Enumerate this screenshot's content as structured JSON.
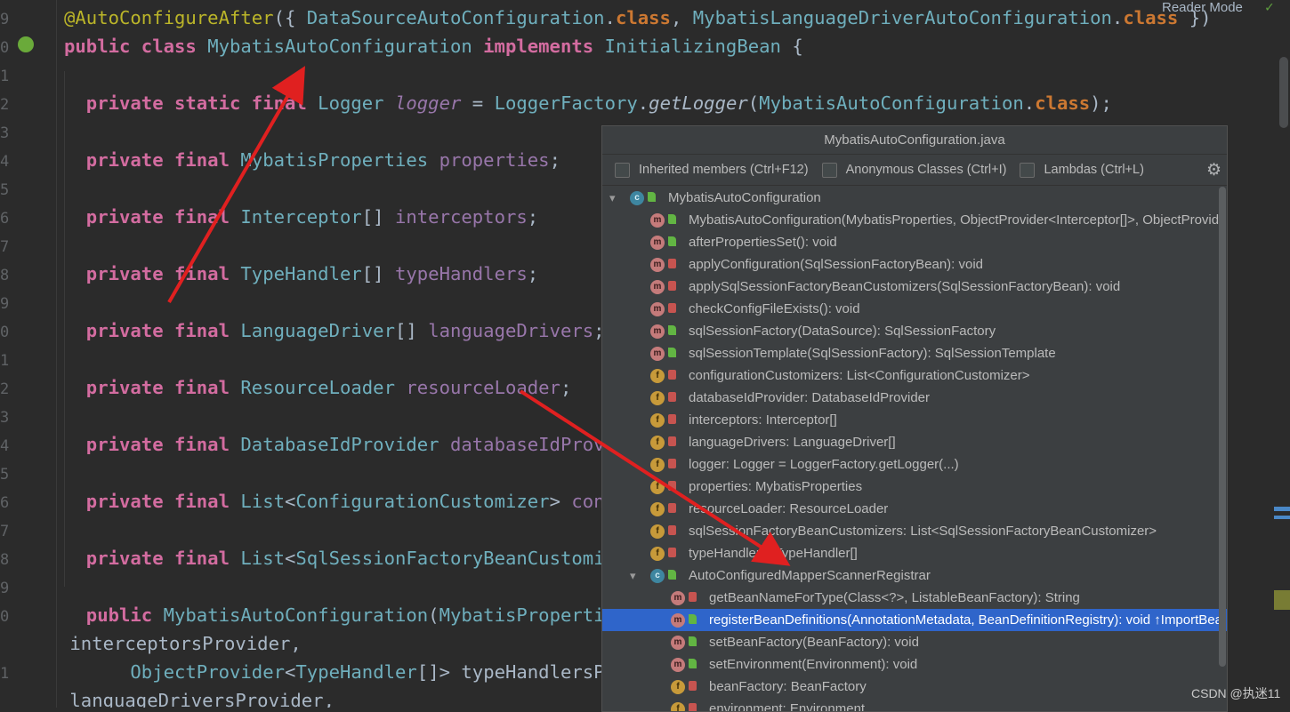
{
  "editor": {
    "gutter_numbers": [
      "9",
      "0",
      "1",
      "2",
      "3",
      "4",
      "5",
      "6",
      "7",
      "8",
      "9",
      "0",
      "1",
      "2",
      "3",
      "4",
      "5",
      "6",
      "7",
      "8",
      "9",
      "0",
      "",
      "1"
    ],
    "top_right_label": "Reader Mode",
    "watermark": "CSDN @执迷11",
    "lines": [
      {
        "t": [
          [
            "ann",
            "@AutoConfigureAfter"
          ],
          [
            "pun",
            "({ "
          ],
          [
            "cls",
            "DataSourceAutoConfiguration"
          ],
          [
            "pun",
            "."
          ],
          [
            "kw",
            "class"
          ],
          [
            "pun",
            ", "
          ],
          [
            "cls",
            "MybatisLanguageDriverAutoConfiguration"
          ],
          [
            "pun",
            "."
          ],
          [
            "kw",
            "class"
          ],
          [
            "pun",
            " })"
          ]
        ]
      },
      {
        "t": [
          [
            "kwp",
            "public class "
          ],
          [
            "cls",
            "MybatisAutoConfiguration "
          ],
          [
            "kwp",
            "implements "
          ],
          [
            "cls",
            "InitializingBean "
          ],
          [
            "pun",
            "{"
          ]
        ]
      },
      {
        "t": []
      },
      {
        "t": [
          [
            "kwp",
            "  private static final "
          ],
          [
            "cls",
            "Logger "
          ],
          [
            "ifld",
            "logger"
          ],
          [
            "pun",
            " = "
          ],
          [
            "cls",
            "LoggerFactory"
          ],
          [
            "pun",
            "."
          ],
          [
            "imeth",
            "getLogger"
          ],
          [
            "pun",
            "("
          ],
          [
            "cls",
            "MybatisAutoConfiguration"
          ],
          [
            "pun",
            "."
          ],
          [
            "kw",
            "class"
          ],
          [
            "pun",
            ");"
          ]
        ]
      },
      {
        "t": []
      },
      {
        "t": [
          [
            "kwp",
            "  private final "
          ],
          [
            "cls",
            "MybatisProperties "
          ],
          [
            "fld",
            "properties"
          ],
          [
            "pun",
            ";"
          ]
        ]
      },
      {
        "t": []
      },
      {
        "t": [
          [
            "kwp",
            "  private final "
          ],
          [
            "cls",
            "Interceptor"
          ],
          [
            "pun",
            "[] "
          ],
          [
            "fld",
            "interceptors"
          ],
          [
            "pun",
            ";"
          ]
        ]
      },
      {
        "t": []
      },
      {
        "t": [
          [
            "kwp",
            "  private final "
          ],
          [
            "cls",
            "TypeHandler"
          ],
          [
            "pun",
            "[] "
          ],
          [
            "fld",
            "typeHandlers"
          ],
          [
            "pun",
            ";"
          ]
        ]
      },
      {
        "t": []
      },
      {
        "t": [
          [
            "kwp",
            "  private final "
          ],
          [
            "cls",
            "LanguageDriver"
          ],
          [
            "pun",
            "[] "
          ],
          [
            "fld",
            "languageDrivers"
          ],
          [
            "pun",
            ";"
          ]
        ]
      },
      {
        "t": []
      },
      {
        "t": [
          [
            "kwp",
            "  private final "
          ],
          [
            "cls",
            "ResourceLoader "
          ],
          [
            "fld",
            "resourceLoader"
          ],
          [
            "pun",
            ";"
          ]
        ]
      },
      {
        "t": []
      },
      {
        "t": [
          [
            "kwp",
            "  private final "
          ],
          [
            "cls",
            "DatabaseIdProvider "
          ],
          [
            "fld",
            "databaseIdProvi"
          ]
        ]
      },
      {
        "t": []
      },
      {
        "t": [
          [
            "kwp",
            "  private final "
          ],
          [
            "cls",
            "List"
          ],
          [
            "pun",
            "<"
          ],
          [
            "cls",
            "ConfigurationCustomizer"
          ],
          [
            "pun",
            "> "
          ],
          [
            "fld",
            "conf"
          ]
        ]
      },
      {
        "t": []
      },
      {
        "t": [
          [
            "kwp",
            "  private final "
          ],
          [
            "cls",
            "List"
          ],
          [
            "pun",
            "<"
          ],
          [
            "cls",
            "SqlSessionFactoryBeanCustomize"
          ]
        ]
      },
      {
        "t": []
      },
      {
        "t": [
          [
            "kwp",
            "  public "
          ],
          [
            "cls",
            "MybatisAutoConfiguration"
          ],
          [
            "pun",
            "("
          ],
          [
            "cls",
            "MybatisPropertie"
          ]
        ]
      },
      {
        "t": [
          [
            "pun",
            " interceptorsProvider,"
          ]
        ]
      },
      {
        "t": [
          [
            "pun",
            "      "
          ],
          [
            "cls",
            "ObjectProvider"
          ],
          [
            "pun",
            "<"
          ],
          [
            "cls",
            "TypeHandler"
          ],
          [
            "pun",
            "[]> typeHandlersPro"
          ]
        ]
      },
      {
        "t": [
          [
            "pun",
            " languageDriversProvider,"
          ]
        ]
      }
    ]
  },
  "popup": {
    "title": "MybatisAutoConfiguration.java",
    "filters": [
      {
        "label": "Inherited members (Ctrl+F12)"
      },
      {
        "label": "Anonymous Classes (Ctrl+I)"
      },
      {
        "label": "Lambdas (Ctrl+L)"
      }
    ],
    "gear_icon": "gear-icon",
    "items": [
      {
        "indent": 0,
        "chev": "⌄",
        "kind": "c",
        "vis": "pub",
        "label": "MybatisAutoConfiguration"
      },
      {
        "indent": 1,
        "kind": "m",
        "vis": "pub",
        "label": "MybatisAutoConfiguration(MybatisProperties, ObjectProvider<Interceptor[]>, ObjectProvider"
      },
      {
        "indent": 1,
        "kind": "m",
        "vis": "pub",
        "label": "afterPropertiesSet(): void"
      },
      {
        "indent": 1,
        "kind": "m",
        "vis": "lock",
        "label": "applyConfiguration(SqlSessionFactoryBean): void"
      },
      {
        "indent": 1,
        "kind": "m",
        "vis": "lock",
        "label": "applySqlSessionFactoryBeanCustomizers(SqlSessionFactoryBean): void"
      },
      {
        "indent": 1,
        "kind": "m",
        "vis": "lock",
        "label": "checkConfigFileExists(): void"
      },
      {
        "indent": 1,
        "kind": "m",
        "vis": "pub",
        "label": "sqlSessionFactory(DataSource): SqlSessionFactory"
      },
      {
        "indent": 1,
        "kind": "m",
        "vis": "pub",
        "label": "sqlSessionTemplate(SqlSessionFactory): SqlSessionTemplate"
      },
      {
        "indent": 1,
        "kind": "f",
        "vis": "lock",
        "label": "configurationCustomizers: List<ConfigurationCustomizer>"
      },
      {
        "indent": 1,
        "kind": "f",
        "vis": "lock",
        "label": "databaseIdProvider: DatabaseIdProvider"
      },
      {
        "indent": 1,
        "kind": "f",
        "vis": "lock",
        "label": "interceptors: Interceptor[]"
      },
      {
        "indent": 1,
        "kind": "f",
        "vis": "lock",
        "label": "languageDrivers: LanguageDriver[]"
      },
      {
        "indent": 1,
        "kind": "f",
        "vis": "lock",
        "label": "logger: Logger = LoggerFactory.getLogger(...)"
      },
      {
        "indent": 1,
        "kind": "f",
        "vis": "lock",
        "label": "properties: MybatisProperties"
      },
      {
        "indent": 1,
        "kind": "f",
        "vis": "lock",
        "label": "resourceLoader: ResourceLoader"
      },
      {
        "indent": 1,
        "kind": "f",
        "vis": "lock",
        "label": "sqlSessionFactoryBeanCustomizers: List<SqlSessionFactoryBeanCustomizer>"
      },
      {
        "indent": 1,
        "kind": "f",
        "vis": "lock",
        "label": "typeHandlers: TypeHandler[]"
      },
      {
        "indent": 1,
        "chev": "⌄",
        "kind": "c",
        "vis": "pub",
        "label": "AutoConfiguredMapperScannerRegistrar"
      },
      {
        "indent": 2,
        "kind": "m",
        "vis": "lock",
        "label": "getBeanNameForType(Class<?>, ListableBeanFactory): String"
      },
      {
        "indent": 2,
        "kind": "m",
        "vis": "pub",
        "label": "registerBeanDefinitions(AnnotationMetadata, BeanDefinitionRegistry): void ↑ImportBea",
        "selected": true
      },
      {
        "indent": 2,
        "kind": "m",
        "vis": "pub",
        "label": "setBeanFactory(BeanFactory): void"
      },
      {
        "indent": 2,
        "kind": "m",
        "vis": "pub",
        "label": "setEnvironment(Environment): void"
      },
      {
        "indent": 2,
        "kind": "f",
        "vis": "lock",
        "label": "beanFactory: BeanFactory"
      },
      {
        "indent": 2,
        "kind": "f",
        "vis": "lock",
        "label": "environment: Environment"
      }
    ]
  },
  "colors": {
    "background": "#2b2b2b",
    "popup": "#3c3f41",
    "selection": "#2f65ca",
    "arrow": "#e02020"
  }
}
